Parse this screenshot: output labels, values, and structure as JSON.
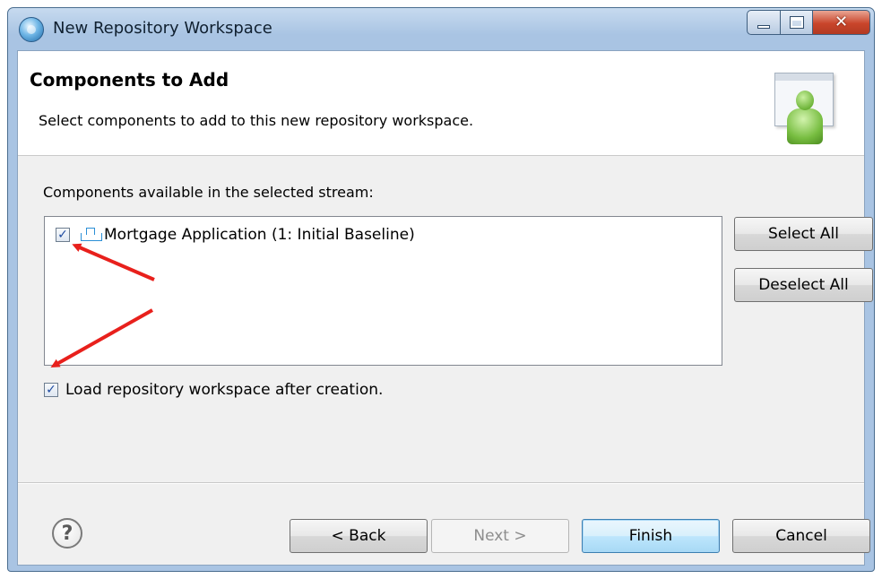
{
  "window": {
    "title": "New Repository Workspace",
    "close_glyph": "✕",
    "icons": [
      "app-icon",
      "minimize-icon",
      "maximize-icon",
      "close-icon"
    ]
  },
  "header": {
    "title": "Components to Add",
    "description": "Select components to add to this new repository workspace.",
    "graphic_icon": "user-window-wizard-icon"
  },
  "components": {
    "label": "Components available in the selected stream:",
    "items": [
      {
        "label": "Mortgage Application (1: Initial Baseline)",
        "checked": true,
        "icon": "component-icon"
      }
    ],
    "select_all_label": "Select All",
    "deselect_all_label": "Deselect All"
  },
  "load_option": {
    "label": "Load repository workspace after creation.",
    "checked": true
  },
  "checkmark_glyph": "✓",
  "footer": {
    "help_glyph": "?",
    "back_label": "< Back",
    "next_label": "Next >",
    "finish_label": "Finish",
    "cancel_label": "Cancel"
  },
  "annotations": {
    "arrow_color": "#e8201c",
    "arrow_count": 2
  }
}
